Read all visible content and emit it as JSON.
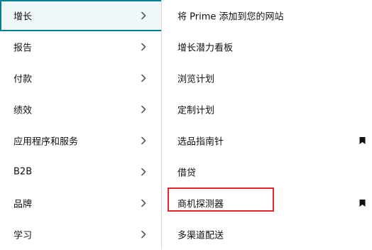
{
  "menu": {
    "items": [
      {
        "label": "增长",
        "active": true
      },
      {
        "label": "报告"
      },
      {
        "label": "付款"
      },
      {
        "label": "绩效"
      },
      {
        "label": "应用程序和服务"
      },
      {
        "label": "B2B"
      },
      {
        "label": "品牌"
      },
      {
        "label": "学习"
      }
    ]
  },
  "submenu": {
    "items": [
      {
        "label": "将 Prime 添加到您的网站"
      },
      {
        "label": "增长潜力看板"
      },
      {
        "label": "浏览计划"
      },
      {
        "label": "定制计划"
      },
      {
        "label": "选品指南针",
        "bookmark": true
      },
      {
        "label": "借贷"
      },
      {
        "label": "商机探测器",
        "bookmark": true,
        "highlighted": true
      },
      {
        "label": "多渠道配送"
      }
    ]
  },
  "colors": {
    "active_border": "#008296",
    "active_background": "#f0f7f8",
    "highlight_box": "#e0262b",
    "divider": "#d5d9d9",
    "chevron": "#565959",
    "bookmark": "#0f1111"
  },
  "icons": {
    "menu_item": "chevron-right-icon",
    "submenu_item": "bookmark-icon"
  }
}
